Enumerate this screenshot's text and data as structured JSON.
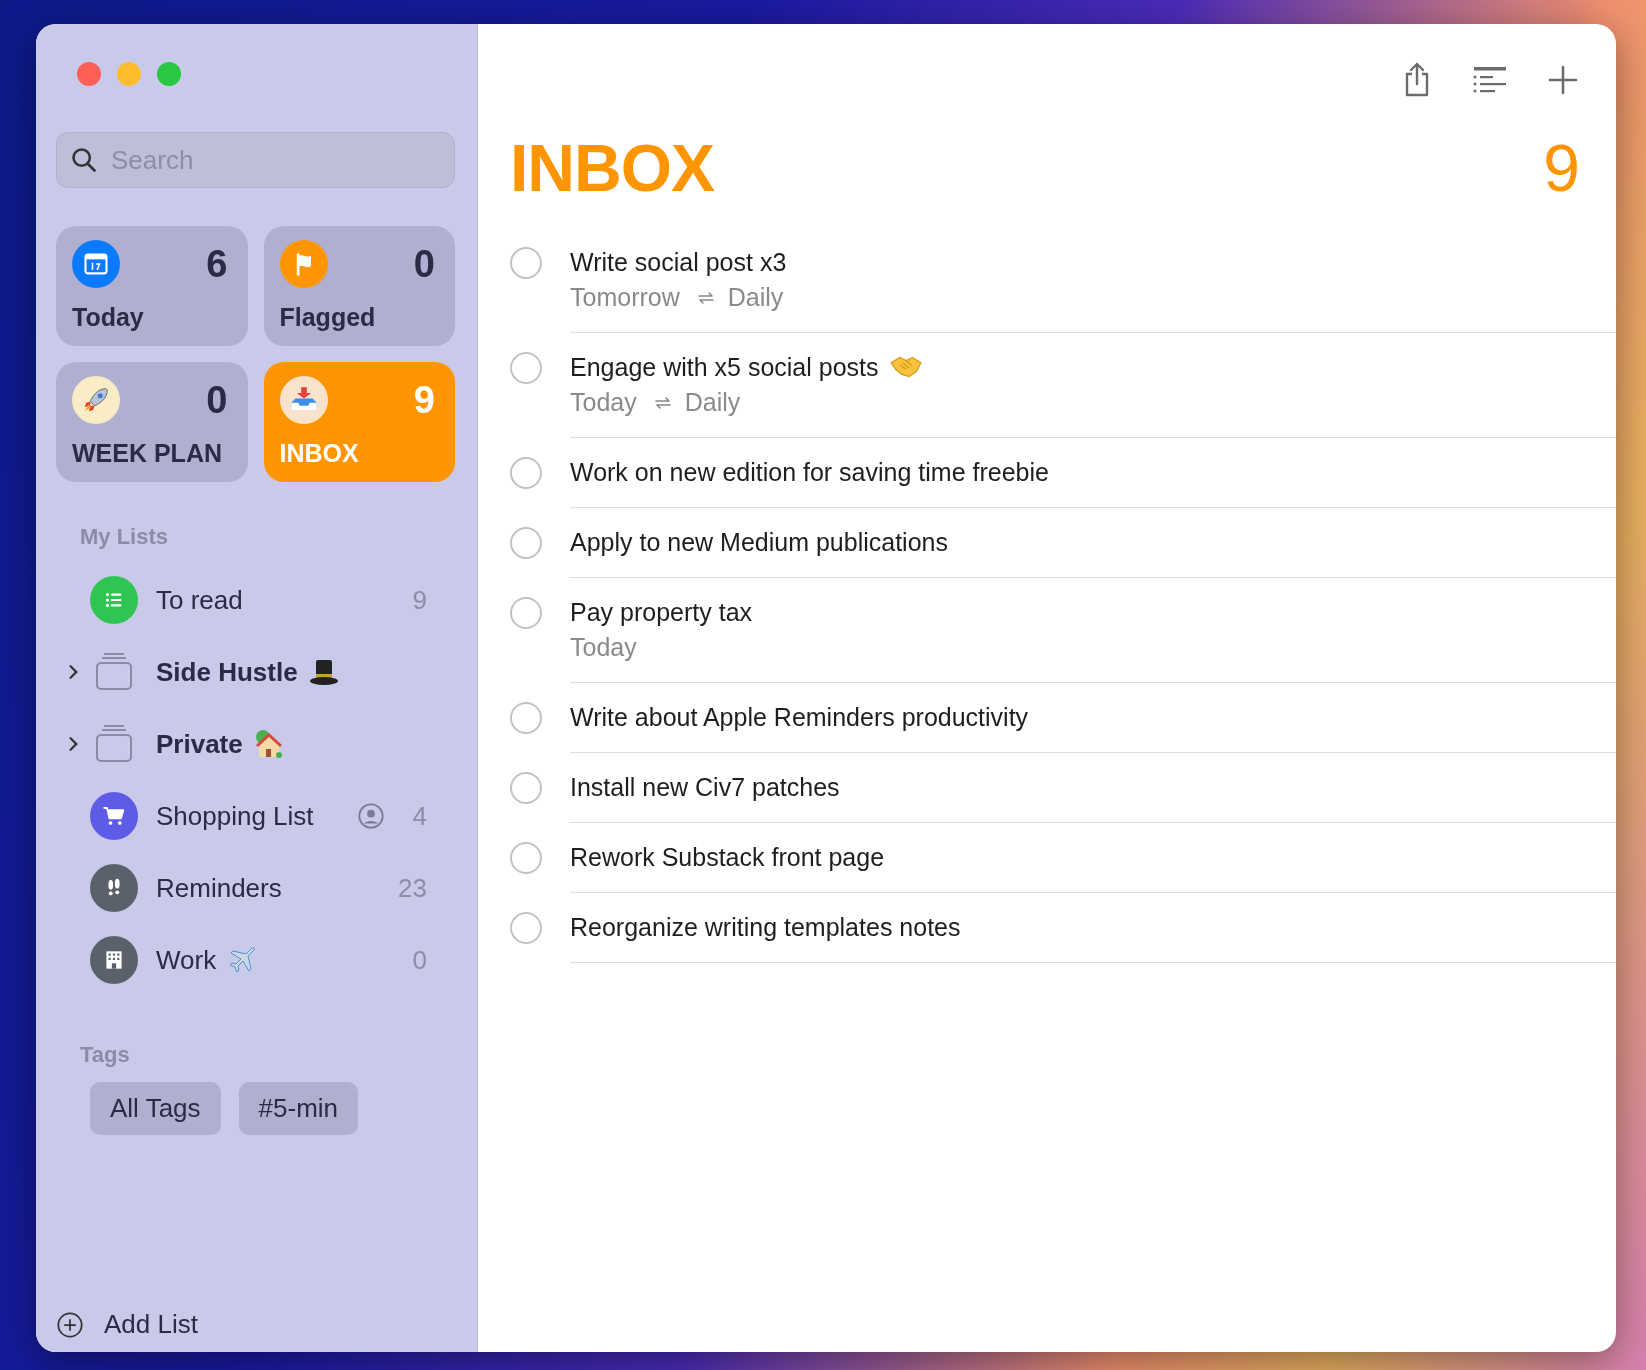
{
  "sidebar": {
    "search": {
      "placeholder": "Search"
    },
    "smart_lists": [
      {
        "label": "Today",
        "count": "6",
        "selected": false,
        "color": "#0a7aff"
      },
      {
        "label": "Flagged",
        "count": "0",
        "selected": false,
        "color": "#ff9500"
      },
      {
        "label": "WEEK PLAN",
        "count": "0",
        "selected": false,
        "color": "#fbecc8"
      },
      {
        "label": "INBOX",
        "count": "9",
        "selected": true,
        "color": "#fae3cc"
      }
    ],
    "my_lists_header": "My Lists",
    "lists": [
      {
        "kind": "list",
        "name": "To read",
        "count": "9",
        "color": "#30c552"
      },
      {
        "kind": "group",
        "name": "Side Hustle",
        "expanded": false
      },
      {
        "kind": "group",
        "name": "Private",
        "expanded": false
      },
      {
        "kind": "list",
        "name": "Shopping List",
        "count": "4",
        "color": "#5e5ce6",
        "shared": true
      },
      {
        "kind": "list",
        "name": "Reminders",
        "count": "23",
        "color": "#5b616b"
      },
      {
        "kind": "list",
        "name": "Work",
        "count": "0",
        "color": "#5b616b"
      }
    ],
    "tags_header": "Tags",
    "tags": [
      "All Tags",
      "#5-min"
    ],
    "add_list": "Add List"
  },
  "main": {
    "title": "INBOX",
    "count": "9",
    "tasks": [
      {
        "title": "Write social post x3",
        "due": "Tomorrow",
        "repeat": "Daily",
        "completed": false
      },
      {
        "title": "Engage with x5 social posts",
        "due": "Today",
        "repeat": "Daily",
        "completed": false
      },
      {
        "title": "Work on new edition for saving time freebie",
        "completed": false
      },
      {
        "title": "Apply to new Medium publications",
        "completed": false
      },
      {
        "title": "Pay property tax",
        "due": "Today",
        "completed": false
      },
      {
        "title": "Write about Apple Reminders productivity",
        "completed": false
      },
      {
        "title": "Install new Civ7 patches",
        "completed": false
      },
      {
        "title": "Rework Substack front page",
        "completed": false
      },
      {
        "title": "Reorganize writing templates notes",
        "completed": false
      }
    ]
  }
}
